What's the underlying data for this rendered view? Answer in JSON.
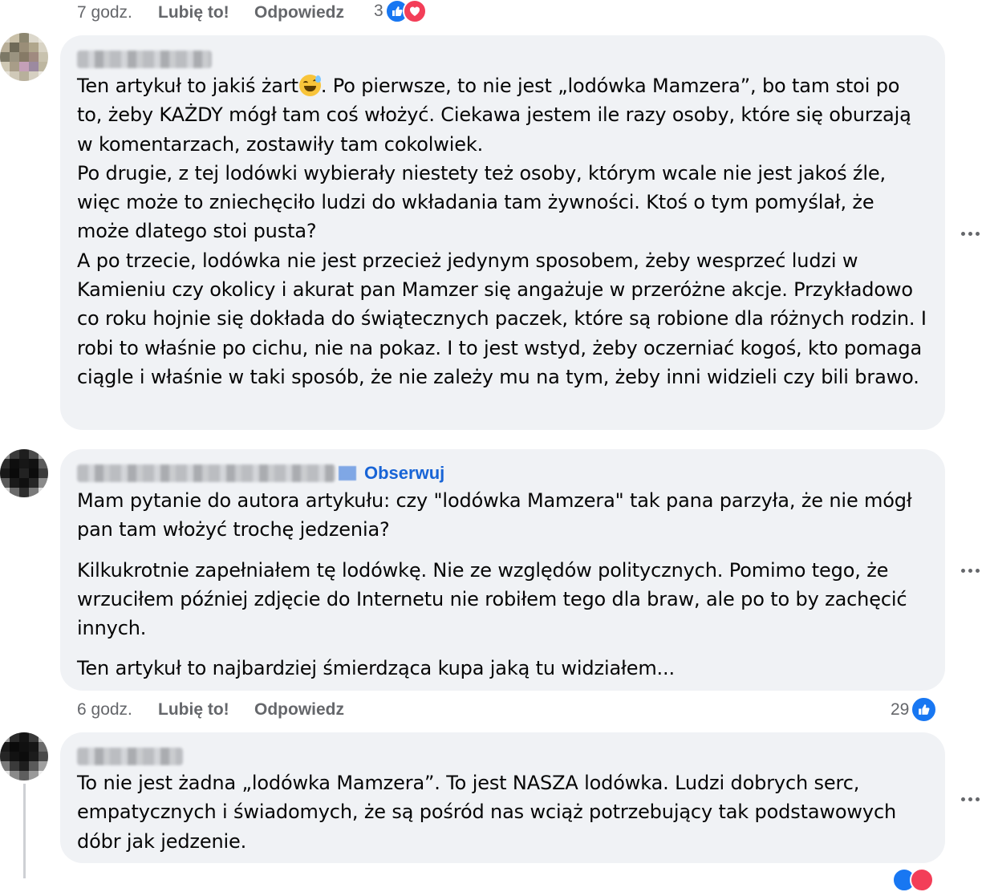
{
  "top_meta": {
    "time": "7 godz.",
    "like_label": "Lubię to!",
    "reply_label": "Odpowiedz",
    "reaction_count": "3",
    "reactions": [
      "like-icon",
      "love-icon"
    ]
  },
  "comments": [
    {
      "follow_label": "",
      "paragraphs": [
        "Ten artykuł to jakiś żart",
        ". Po pierwsze, to nie jest „lodówka Mamzera”, bo tam stoi po to, żeby KAŻDY mógł tam coś włożyć. Ciekawa jestem ile razy osoby, które się oburzają w komentarzach, zostawiły tam cokolwiek.",
        "Po drugie, z tej lodówki wybierały niestety też osoby, którym wcale nie jest jakoś źle, więc może to zniechęciło ludzi do wkładania tam żywności. Ktoś o tym pomyślał, że może dlatego stoi pusta?",
        "A po trzecie, lodówka nie jest przecież jedynym sposobem, żeby wesprzeć ludzi w Kamieniu czy okolicy i akurat pan Mamzer się angażuje w przeróżne akcje. Przykładowo co roku hojnie się dokłada do świątecznych paczek, które są robione dla różnych rodzin. I robi to właśnie po cichu, nie na pokaz. I to jest wstyd, żeby oczerniać kogoś, kto pomaga ciągle i właśnie w taki sposób, że nie zależy mu na tym, żeby inni widzieli czy bili brawo."
      ],
      "emoji": "grinning-sweat-emoji"
    },
    {
      "follow_label": "Obserwuj",
      "paragraphs": [
        "Mam pytanie do autora artykułu: czy \"lodówka Mamzera\" tak pana parzyła, że nie mógł pan tam włożyć trochę jedzenia?",
        "Kilkukrotnie zapełniałem tę lodówkę. Nie ze względów politycznych. Pomimo tego, że wrzuciłem później zdjęcie do Internetu nie robiłem tego dla braw, ale po to by zachęcić innych.",
        "Ten artykuł to najbardziej śmierdząca kupa jaką tu widziałem..."
      ],
      "meta": {
        "time": "6 godz.",
        "like_label": "Lubię to!",
        "reply_label": "Odpowiedz",
        "reaction_count": "29",
        "reactions": [
          "like-icon"
        ]
      }
    },
    {
      "follow_label": "",
      "paragraphs": [
        "To nie jest żadna „lodówka Mamzera”. To jest NASZA lodówka. Ludzi dobrych serc, empatycznych i świadomych, że są pośród nas wciąż potrzebujący tak podstawowych dóbr jak jedzenie."
      ]
    }
  ],
  "colors": {
    "bubble": "#f0f2f5",
    "meta_text": "#65676b",
    "link_blue": "#1864d6",
    "like_blue": "#1877f2",
    "love_red": "#f33e58"
  },
  "more_icon": "more-options-icon"
}
